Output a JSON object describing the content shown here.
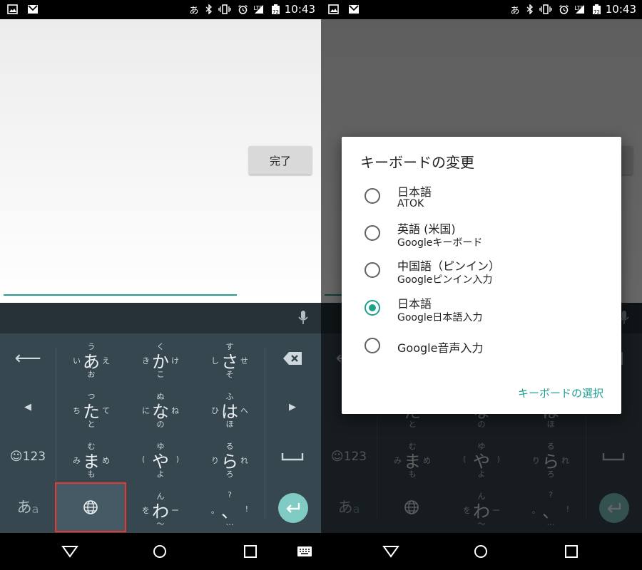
{
  "status_bar": {
    "ime_indicator": "あ",
    "network": "LTE",
    "battery": "72",
    "time": "10:43",
    "icons": [
      "image-icon",
      "gmail-icon",
      "bluetooth-icon",
      "vibrate-icon",
      "alarm-icon",
      "signal-icon",
      "battery-icon"
    ]
  },
  "app": {
    "done_label": "完了",
    "accent_color": "#1f9f8f"
  },
  "keyboard": {
    "left_keys": {
      "back": "⟵",
      "cursor_left": "◀",
      "emoji_num": "☺123",
      "mode": "あ",
      "mode_small": "a"
    },
    "right_keys": {
      "delete": "✕",
      "cursor_right": "▶",
      "space": "⎵"
    },
    "rows": [
      [
        {
          "c": "あ",
          "u": "う",
          "d": "お",
          "l": "い",
          "r": "え"
        },
        {
          "c": "か",
          "u": "く",
          "d": "こ",
          "l": "き",
          "r": "け"
        },
        {
          "c": "さ",
          "u": "す",
          "d": "そ",
          "l": "し",
          "r": "せ"
        }
      ],
      [
        {
          "c": "た",
          "u": "つ",
          "d": "と",
          "l": "ち",
          "r": "て"
        },
        {
          "c": "な",
          "u": "ぬ",
          "d": "の",
          "l": "に",
          "r": "ね"
        },
        {
          "c": "は",
          "u": "ふ",
          "d": "ほ",
          "l": "ひ",
          "r": "へ"
        }
      ],
      [
        {
          "c": "ま",
          "u": "む",
          "d": "も",
          "l": "み",
          "r": "め"
        },
        {
          "c": "や",
          "u": "ゆ",
          "d": "よ",
          "l": "(",
          "r": ")"
        },
        {
          "c": "ら",
          "u": "る",
          "d": "ろ",
          "l": "り",
          "r": "れ"
        }
      ]
    ],
    "bottom_row": {
      "wa": {
        "c": "わ",
        "u": "ん",
        "d": "〜",
        "l": "を",
        "r": "ー"
      },
      "punct": {
        "c": "、",
        "u": "?",
        "d": "…",
        "l": "。",
        "r": "!"
      }
    }
  },
  "dialog": {
    "title": "キーボードの変更",
    "options": [
      {
        "main": "日本語",
        "sub": "ATOK",
        "selected": false
      },
      {
        "main": "英語 (米国)",
        "sub": "Googleキーボード",
        "selected": false
      },
      {
        "main": "中国語（ピンイン）",
        "sub": "Googleピンイン入力",
        "selected": false
      },
      {
        "main": "日本語",
        "sub": "Google日本語入力",
        "selected": true
      },
      {
        "main": "Google音声入力",
        "sub": "",
        "selected": false
      }
    ],
    "action": "キーボードの選択"
  },
  "highlight_color": "#e53935"
}
